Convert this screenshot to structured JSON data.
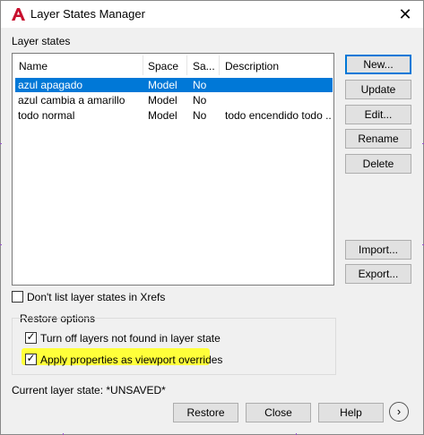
{
  "window": {
    "title": "Layer States Manager",
    "close_glyph": "✕"
  },
  "layer_states_label": "Layer states",
  "table": {
    "columns": [
      "Name",
      "Space",
      "Sa...",
      "Description"
    ],
    "rows": [
      {
        "name": "azul apagado",
        "space": "Model",
        "saved": "No",
        "description": "",
        "selected": true
      },
      {
        "name": "azul cambia a amarillo",
        "space": "Model",
        "saved": "No",
        "description": ""
      },
      {
        "name": "todo normal",
        "space": "Model",
        "saved": "No",
        "description": "todo encendido todo ..."
      }
    ]
  },
  "side_buttons": {
    "new": "New...",
    "update": "Update",
    "edit": "Edit...",
    "rename": "Rename",
    "delete": "Delete",
    "import": "Import...",
    "export": "Export..."
  },
  "dont_list_xrefs": {
    "label": "Don't list layer states in Xrefs",
    "checked": false
  },
  "restore_options": {
    "label": "Restore options",
    "turn_off": {
      "label": "Turn off layers not found in layer state",
      "checked": true
    },
    "apply_props": {
      "label": "Apply properties as viewport overrides",
      "checked": true
    }
  },
  "current_state": "Current layer state: *UNSAVED*",
  "bottom_buttons": {
    "restore": "Restore",
    "close": "Close",
    "help": "Help",
    "more": "›"
  },
  "colors": {
    "selection": "#0078d7",
    "highlight": "#ffff3a",
    "app_icon": "#c8102e"
  },
  "icons": {
    "app": "autocad-a-icon",
    "close": "close-icon",
    "more": "chevron-right-icon"
  }
}
